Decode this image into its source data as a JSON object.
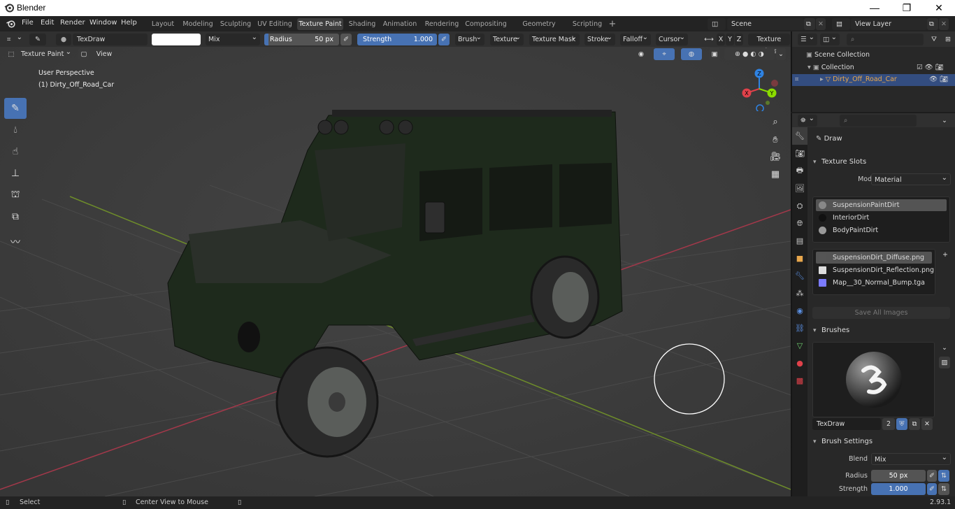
{
  "window": {
    "title": "Blender",
    "min": "—",
    "max": "❐",
    "close": "✕"
  },
  "menu": [
    "File",
    "Edit",
    "Render",
    "Window",
    "Help"
  ],
  "workspaces": [
    "Layout",
    "Modeling",
    "Sculpting",
    "UV Editing",
    "Texture Paint",
    "Shading",
    "Animation",
    "Rendering",
    "Compositing",
    "Geometry Nodes",
    "Scripting"
  ],
  "workspace_add": "+",
  "scene": {
    "name": "Scene",
    "view_layer": "View Layer"
  },
  "tool_header": {
    "brush_name": "TexDraw",
    "blend": "Mix",
    "radius_label": "Radius",
    "radius_value": "50 px",
    "strength_label": "Strength",
    "strength_value": "1.000",
    "strength_fraction": 1.0,
    "menus": [
      "Brush",
      "Texture",
      "Texture Mask",
      "Stroke",
      "Falloff",
      "Cursor"
    ],
    "xyz": [
      "X",
      "Y",
      "Z"
    ],
    "texture_slots": "Texture Slots"
  },
  "view_header": {
    "mode": "Texture Paint",
    "view": "View"
  },
  "overlay": {
    "perspective": "User Perspective",
    "object": "(1) Dirty_Off_Road_Car"
  },
  "gizmo": {
    "x": "X",
    "y": "Y",
    "z": "Z"
  },
  "outliner": {
    "scene_collection": "Scene Collection",
    "collection": "Collection",
    "object": "Dirty_Off_Road_Car"
  },
  "properties": {
    "brush_label": "Draw",
    "texture_slots_header": "Texture Slots",
    "mode_label": "Mode",
    "mode_value": "Material",
    "materials": [
      "SuspensionPaintDirt",
      "InteriorDirt",
      "BodyPaintDirt"
    ],
    "images": [
      "SuspensionDirt_Diffuse.png",
      "SuspensionDirt_Reflection.png",
      "Map__30_Normal_Bump.tga"
    ],
    "save_all": "Save All Images",
    "brushes_header": "Brushes",
    "brush_name": "TexDraw",
    "brush_users": "2",
    "brush_settings_header": "Brush Settings",
    "blend_label": "Blend",
    "blend_value": "Mix",
    "radius_label": "Radius",
    "radius_value": "50 px",
    "strength_label": "Strength",
    "strength_value": "1.000"
  },
  "status": {
    "select": "Select",
    "center": "Center View to Mouse",
    "version": "2.93.1"
  },
  "colors": {
    "accent": "#4772b3",
    "x_axis": "#e0414a",
    "y_axis": "#8bdc00",
    "z_axis": "#2f83e3",
    "object_active": "#e8a74d"
  }
}
